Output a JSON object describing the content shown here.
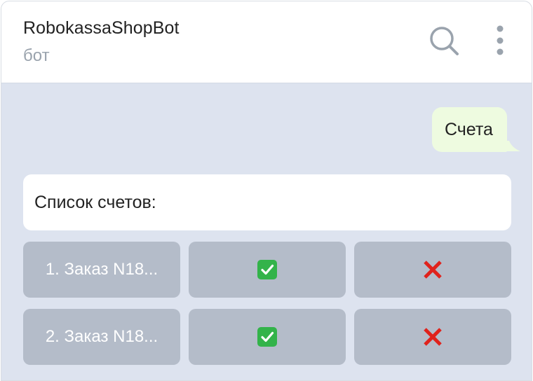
{
  "header": {
    "title": "RobokassaShopBot",
    "subtitle": "бот"
  },
  "messages": {
    "outgoing_text": "Счета",
    "incoming_text": "Список счетов:"
  },
  "keyboard": {
    "rows": [
      {
        "order_label": "1. Заказ N18...",
        "confirm_icon": "check-mark-button-icon",
        "cancel_icon": "cross-mark-icon"
      },
      {
        "order_label": "2. Заказ N18...",
        "confirm_icon": "check-mark-button-icon",
        "cancel_icon": "cross-mark-icon"
      }
    ]
  },
  "colors": {
    "chat_background": "#dde3ef",
    "outgoing_bubble": "#eefbe0",
    "keyboard_button": "#b4bcc9",
    "check_green": "#33b34a",
    "cross_red": "#e0221c"
  }
}
